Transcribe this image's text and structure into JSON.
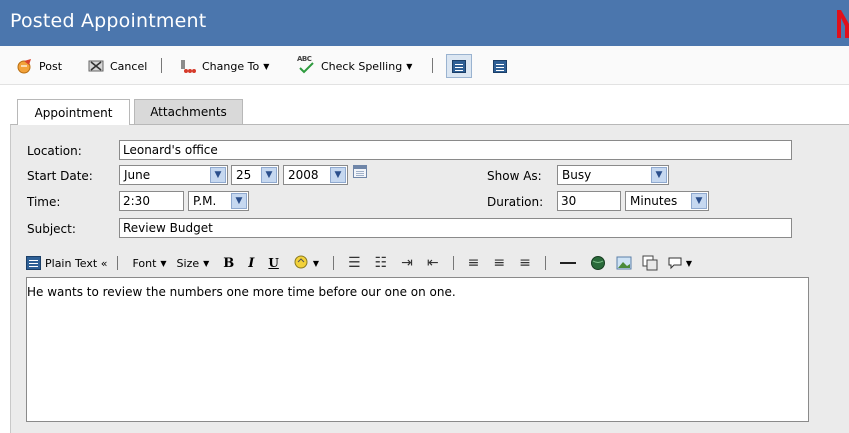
{
  "window": {
    "title": "Posted Appointment"
  },
  "toolbar": {
    "post_label": "Post",
    "cancel_label": "Cancel",
    "change_to_label": "Change To",
    "check_spelling_label": "Check Spelling",
    "abc_text": "ABC"
  },
  "tabs": [
    {
      "label": "Appointment",
      "active": true
    },
    {
      "label": "Attachments",
      "active": false
    }
  ],
  "form": {
    "location": {
      "label": "Location:",
      "value": "Leonard's office"
    },
    "start_date": {
      "label": "Start Date:",
      "month": "June",
      "day": "25",
      "year": "2008"
    },
    "show_as": {
      "label": "Show As:",
      "value": "Busy"
    },
    "time": {
      "label": "Time:",
      "value": "2:30",
      "ampm": "P.M."
    },
    "duration": {
      "label": "Duration:",
      "value": "30",
      "unit": "Minutes"
    },
    "subject": {
      "label": "Subject:",
      "value": "Review Budget"
    }
  },
  "editor_toolbar": {
    "plain_text_label": "Plain Text «",
    "font_label": "Font",
    "size_label": "Size",
    "bold": "B",
    "italic": "I",
    "underline": "U"
  },
  "body_text": "He wants to review the numbers one more time before our one on one.",
  "colors": {
    "title_bar": "#4b76ad",
    "panel_bg": "#ebebeb",
    "corner_logo": "#e0101c"
  }
}
